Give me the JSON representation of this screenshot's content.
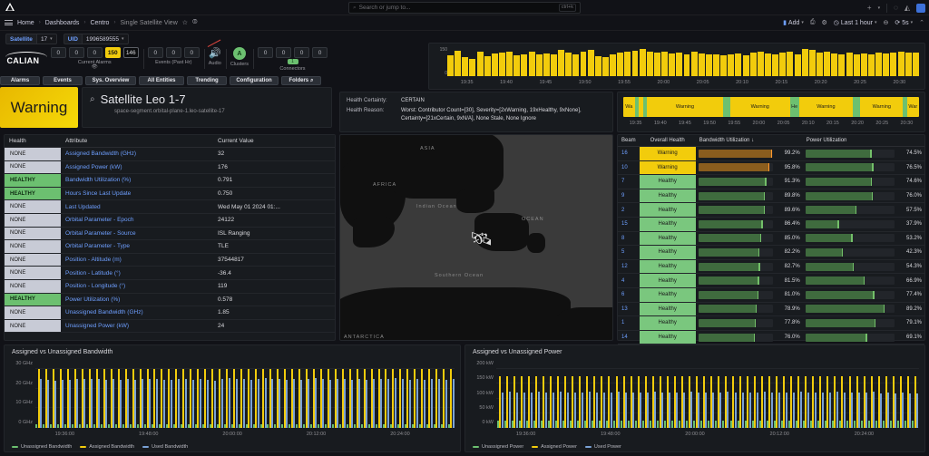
{
  "topbar": {
    "logo_icon": "grafana-logo-icon",
    "search_placeholder": "Search or jump to...",
    "search_kbd": "ctrl+k",
    "plus_label": "+",
    "help_icon": "help-circle-icon",
    "news_icon": "news-icon",
    "avatar_icon": "user-avatar"
  },
  "breadcrumb": {
    "menu_icon": "hamburger-menu-icon",
    "items": [
      "Home",
      "Dashboards",
      "Centro",
      "Single Satellite View"
    ],
    "star_icon": "star-icon",
    "share_icon": "share-icon",
    "add_label": "Add",
    "save_icon": "save-icon",
    "settings_icon": "gear-icon",
    "time_range": "Last 1 hour",
    "zoom_out_icon": "zoom-out-icon",
    "refresh_icon": "refresh-icon",
    "refresh_interval": "5s",
    "collapse_icon": "chevron-up-icon"
  },
  "variables": [
    {
      "label": "Satellite",
      "value": "17"
    },
    {
      "label": "UID",
      "value": "1996589555"
    }
  ],
  "calian": {
    "brand": "CALIAN",
    "alarm_chips": [
      "0",
      "0",
      "0",
      "150",
      "146"
    ],
    "alarm_caption": "Current Alarms",
    "alarm_sub_icon": "eye-slash-icon",
    "event_chips": [
      "0",
      "0",
      "0"
    ],
    "event_caption": "Events (Past Hr)",
    "audio_caption": "Audio",
    "audio_icon": "speaker-muted-icon",
    "clusters_caption": "Clusters",
    "cluster_letter": "A",
    "connector_chips": [
      "0",
      "0",
      "0",
      "0"
    ],
    "connector_sub": "1",
    "connector_caption": "Connectors",
    "nav_buttons": [
      "Alarms",
      "Events",
      "Sys. Overview",
      "All Entities",
      "Trending",
      "Configuration",
      "Folders"
    ]
  },
  "status": {
    "badge": "Warning",
    "satellite_name": "Satellite Leo 1-7",
    "satellite_path": "space-segment.orbital-plane-1.leo-satellite-17",
    "search_icon": "magnifier-icon"
  },
  "health": {
    "certainty_label": "Health Certainty:",
    "certainty_value": "CERTAIN",
    "reason_label": "Health Reason:",
    "reason_value": "Worst: Contributor Count=[30], Severity=[2xWarning, 19xHealthy, 9xNone], Certainty=[21xCertain, 9xN/A], None Stale, None Ignore"
  },
  "attributes": {
    "columns": [
      "Health",
      "Attribute",
      "Current Value"
    ],
    "rows": [
      {
        "health": "NONE",
        "attribute": "Assigned Bandwidth (GHz)",
        "value": "32"
      },
      {
        "health": "NONE",
        "attribute": "Assigned Power (kW)",
        "value": "176"
      },
      {
        "health": "HEALTHY",
        "attribute": "Bandwidth Utilization (%)",
        "value": "0.791"
      },
      {
        "health": "HEALTHY",
        "attribute": "Hours Since Last Update",
        "value": "0.750"
      },
      {
        "health": "NONE",
        "attribute": "Last Updated",
        "value": "Wed May 01 2024 01:..."
      },
      {
        "health": "NONE",
        "attribute": "Orbital Parameter - Epoch",
        "value": "24122"
      },
      {
        "health": "NONE",
        "attribute": "Orbital Parameter - Source",
        "value": "ISL Ranging"
      },
      {
        "health": "NONE",
        "attribute": "Orbital Parameter - Type",
        "value": "TLE"
      },
      {
        "health": "NONE",
        "attribute": "Position - Altitude (m)",
        "value": "37544817"
      },
      {
        "health": "NONE",
        "attribute": "Position - Latitude (°)",
        "value": "-36.4"
      },
      {
        "health": "NONE",
        "attribute": "Position - Longitude (°)",
        "value": "119"
      },
      {
        "health": "HEALTHY",
        "attribute": "Power Utilization (%)",
        "value": "0.578"
      },
      {
        "health": "NONE",
        "attribute": "Unassigned Bandwidth (GHz)",
        "value": "1.85"
      },
      {
        "health": "NONE",
        "attribute": "Unassigned Power (kW)",
        "value": "24"
      }
    ]
  },
  "map": {
    "labels": [
      "ASIA",
      "AFRICA",
      "Indian Ocean",
      "OCEAN",
      "Southern Ocean",
      "ANTARCTICA"
    ],
    "marker_icon": "satellite-icon"
  },
  "beams": {
    "columns": [
      "Beam",
      "Overall Health",
      "Bandwidth Utilization",
      "Power Utilization"
    ],
    "sort_icon": "sort-desc-icon",
    "rows": [
      {
        "beam": "16",
        "health": "Warning",
        "bw": 99.2,
        "bw_label": "99.2%",
        "pw": 74.5,
        "pw_label": "74.5%"
      },
      {
        "beam": "10",
        "health": "Warning",
        "bw": 95.8,
        "bw_label": "95.8%",
        "pw": 76.5,
        "pw_label": "76.5%"
      },
      {
        "beam": "7",
        "health": "Healthy",
        "bw": 91.3,
        "bw_label": "91.3%",
        "pw": 74.6,
        "pw_label": "74.6%"
      },
      {
        "beam": "9",
        "health": "Healthy",
        "bw": 89.8,
        "bw_label": "89.8%",
        "pw": 76.0,
        "pw_label": "76.0%"
      },
      {
        "beam": "2",
        "health": "Healthy",
        "bw": 89.6,
        "bw_label": "89.6%",
        "pw": 57.5,
        "pw_label": "57.5%"
      },
      {
        "beam": "15",
        "health": "Healthy",
        "bw": 86.4,
        "bw_label": "86.4%",
        "pw": 37.9,
        "pw_label": "37.9%"
      },
      {
        "beam": "8",
        "health": "Healthy",
        "bw": 85.0,
        "bw_label": "85.0%",
        "pw": 53.2,
        "pw_label": "53.2%"
      },
      {
        "beam": "5",
        "health": "Healthy",
        "bw": 82.2,
        "bw_label": "82.2%",
        "pw": 42.3,
        "pw_label": "42.3%"
      },
      {
        "beam": "12",
        "health": "Healthy",
        "bw": 82.7,
        "bw_label": "82.7%",
        "pw": 54.3,
        "pw_label": "54.3%"
      },
      {
        "beam": "4",
        "health": "Healthy",
        "bw": 81.5,
        "bw_label": "81.5%",
        "pw": 66.9,
        "pw_label": "66.9%"
      },
      {
        "beam": "6",
        "health": "Healthy",
        "bw": 81.0,
        "bw_label": "81.0%",
        "pw": 77.4,
        "pw_label": "77.4%"
      },
      {
        "beam": "13",
        "health": "Healthy",
        "bw": 78.9,
        "bw_label": "78.9%",
        "pw": 89.2,
        "pw_label": "89.2%"
      },
      {
        "beam": "1",
        "health": "Healthy",
        "bw": 77.8,
        "bw_label": "77.8%",
        "pw": 79.1,
        "pw_label": "79.1%"
      },
      {
        "beam": "14",
        "health": "Healthy",
        "bw": 76.0,
        "bw_label": "76.0%",
        "pw": 69.1,
        "pw_label": "69.1%"
      }
    ]
  },
  "chart_data": [
    {
      "type": "bar",
      "name": "alarm-count-history",
      "title": "",
      "ylabel": "",
      "ylim": [
        0,
        150
      ],
      "ticks_y": [
        "0",
        "150"
      ],
      "x_ticks": [
        "19:35",
        "19:40",
        "19:45",
        "19:50",
        "19:55",
        "20:00",
        "20:05",
        "20:10",
        "20:15",
        "20:20",
        "20:25",
        "20:30"
      ],
      "color": "#f2cc0c",
      "values": [
        120,
        148,
        108,
        100,
        142,
        118,
        130,
        136,
        140,
        120,
        126,
        142,
        128,
        130,
        126,
        150,
        138,
        126,
        140,
        152,
        118,
        110,
        128,
        134,
        140,
        148,
        160,
        142,
        136,
        140,
        130,
        136,
        128,
        142,
        132,
        124,
        128,
        122,
        126,
        130,
        122,
        134,
        144,
        130,
        126,
        136,
        140,
        128,
        160,
        150,
        134,
        140,
        130,
        126,
        134,
        128,
        132,
        124,
        136,
        130,
        134,
        142,
        138,
        134
      ]
    },
    {
      "type": "heatmap",
      "name": "health-state-timeline",
      "segments": [
        {
          "state": "Warning",
          "label": "Wa",
          "w": 4
        },
        {
          "state": "Healthy",
          "label": "",
          "w": 1.5
        },
        {
          "state": "Warning",
          "label": "",
          "w": 1.5
        },
        {
          "state": "Healthy",
          "label": "",
          "w": 1.2
        },
        {
          "state": "Warning",
          "label": "Warning",
          "w": 27
        },
        {
          "state": "Healthy",
          "label": "",
          "w": 2.4
        },
        {
          "state": "Warning",
          "label": "Warning",
          "w": 21
        },
        {
          "state": "Healthy",
          "label": "He",
          "w": 3.2
        },
        {
          "state": "Warning",
          "label": "Warning",
          "w": 19
        },
        {
          "state": "Healthy",
          "label": "",
          "w": 2.6
        },
        {
          "state": "Warning",
          "label": "Warning",
          "w": 15
        },
        {
          "state": "Healthy",
          "label": "",
          "w": 1.4
        },
        {
          "state": "Warning",
          "label": "War",
          "w": 4.2
        }
      ],
      "x_ticks": [
        "19:35",
        "19:40",
        "19:45",
        "19:50",
        "19:55",
        "20:00",
        "20:05",
        "20:10",
        "20:15",
        "20:20",
        "20:25",
        "20:30"
      ],
      "colors": {
        "Warning": "#f2cc0c",
        "Healthy": "#6cc070"
      }
    },
    {
      "type": "bar",
      "name": "assigned-vs-unassigned-bandwidth",
      "title": "Assigned vs Unassigned Bandwidth",
      "ylabel": "",
      "ylim": [
        0,
        32
      ],
      "ticks_y": [
        "0 GHz",
        "10 GHz",
        "20 GHz",
        "30 GHz"
      ],
      "x_ticks": [
        "19:36:00",
        "19:48:00",
        "20:00:00",
        "20:12:00",
        "20:24:00"
      ],
      "legend": [
        "Unassigned Bandwidth",
        "Assigned Bandwidth",
        "Used Bandwidth"
      ],
      "legend_colors": [
        "#6cc070",
        "#f2cc0c",
        "#7aa2d6"
      ],
      "series": [
        {
          "name": "Unassigned Bandwidth",
          "values": [
            1.8,
            1.9,
            1.85,
            1.8,
            1.9,
            1.85,
            1.8,
            1.9,
            1.8,
            1.85,
            1.9,
            1.8,
            1.85,
            1.9,
            1.8,
            1.85,
            1.8,
            1.9,
            1.85,
            1.8,
            1.9,
            1.85,
            1.8,
            1.85,
            1.9,
            1.8,
            1.85,
            1.9,
            1.8,
            1.85,
            1.8,
            1.9,
            1.85,
            1.8,
            1.9,
            1.85,
            1.8,
            1.85,
            1.9,
            1.8,
            1.85,
            1.9,
            1.8,
            1.85,
            1.8,
            1.9,
            1.85,
            1.8,
            1.9,
            1.85,
            1.8,
            1.85,
            1.9,
            1.8,
            1.85,
            1.9,
            1.8,
            1.85
          ]
        },
        {
          "name": "Assigned Bandwidth",
          "values": [
            32,
            32,
            32,
            32,
            32,
            32,
            32,
            32,
            32,
            32,
            32,
            32,
            32,
            32,
            32,
            32,
            32,
            32,
            32,
            32,
            32,
            32,
            32,
            32,
            32,
            32,
            32,
            32,
            32,
            32,
            32,
            32,
            32,
            32,
            32,
            32,
            32,
            32,
            32,
            32,
            32,
            32,
            32,
            32,
            32,
            32,
            32,
            32,
            32,
            32,
            32,
            32,
            32,
            32,
            32,
            32,
            32,
            32
          ]
        },
        {
          "name": "Used Bandwidth",
          "values": [
            26.4,
            26.0,
            25.8,
            26.2,
            26.0,
            26.6,
            26.4,
            26.8,
            26.6,
            26.2,
            26.4,
            26.0,
            26.6,
            26.3,
            26.5,
            26.8,
            26.4,
            26.0,
            26.2,
            26.6,
            26.4,
            26.2,
            26.5,
            26.0,
            25.8,
            26.4,
            27.0,
            26.8,
            26.4,
            26.0,
            26.5,
            27.2,
            26.8,
            26.4,
            26.0,
            26.6,
            26.2,
            26.8,
            27.0,
            26.6,
            26.2,
            26.8,
            26.4,
            26.0,
            26.6,
            26.2,
            26.8,
            26.4,
            26.6,
            27.0,
            26.4,
            26.0,
            26.6,
            26.2,
            26.8,
            26.4,
            26.0,
            26.6
          ]
        }
      ]
    },
    {
      "type": "bar",
      "name": "assigned-vs-unassigned-power",
      "title": "Assigned vs Unassigned Power",
      "ylabel": "",
      "ylim": [
        0,
        200
      ],
      "ticks_y": [
        "0 kW",
        "50 kW",
        "100 kW",
        "150 kW",
        "200 kW"
      ],
      "x_ticks": [
        "19:36:00",
        "19:48:00",
        "20:00:00",
        "20:12:00",
        "20:24:00"
      ],
      "legend": [
        "Unassigned Power",
        "Assigned Power",
        "Used Power"
      ],
      "legend_colors": [
        "#6cc070",
        "#f2cc0c",
        "#7aa2d6"
      ],
      "series": [
        {
          "name": "Unassigned Power",
          "values": [
            24,
            24,
            24,
            24,
            24,
            24,
            24,
            24,
            24,
            24,
            24,
            24,
            24,
            24,
            24,
            24,
            24,
            24,
            24,
            24,
            24,
            24,
            24,
            24,
            24,
            24,
            24,
            24,
            24,
            24,
            24,
            24,
            24,
            24,
            24,
            24,
            24,
            24,
            24,
            24,
            24,
            24,
            24,
            24,
            24,
            24,
            24,
            24,
            24,
            24,
            24,
            24,
            24,
            24,
            24,
            24,
            24,
            24
          ]
        },
        {
          "name": "Assigned Power",
          "values": [
            176,
            176,
            176,
            176,
            176,
            176,
            176,
            176,
            176,
            176,
            176,
            176,
            176,
            176,
            176,
            176,
            176,
            176,
            176,
            176,
            176,
            176,
            176,
            176,
            176,
            176,
            176,
            176,
            176,
            176,
            176,
            176,
            176,
            176,
            176,
            176,
            176,
            176,
            176,
            176,
            176,
            176,
            176,
            176,
            176,
            176,
            176,
            176,
            176,
            176,
            176,
            176,
            176,
            176,
            176,
            176,
            176,
            176
          ]
        },
        {
          "name": "Used Power",
          "values": [
            120,
            122,
            121,
            119,
            120,
            122,
            121,
            120,
            122,
            119,
            120,
            121,
            122,
            120,
            119,
            121,
            122,
            120,
            121,
            119,
            120,
            122,
            121,
            120,
            119,
            121,
            122,
            120,
            121,
            119,
            120,
            122,
            121,
            119,
            120,
            121,
            122,
            120,
            119,
            121,
            120,
            122,
            121,
            119,
            120,
            121,
            122,
            120,
            119,
            121,
            120,
            122,
            118,
            120,
            116,
            119,
            117,
            116
          ]
        }
      ]
    }
  ]
}
